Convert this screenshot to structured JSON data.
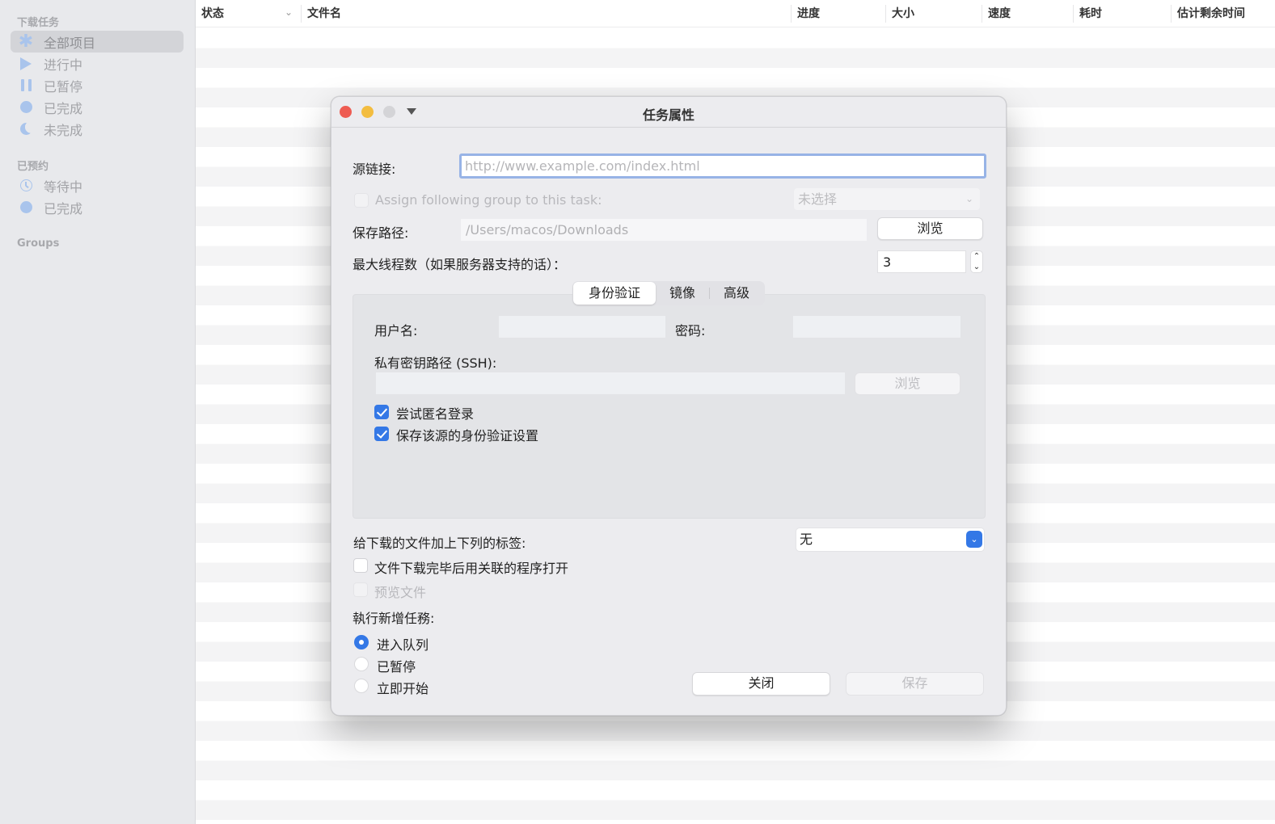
{
  "sidebar": {
    "sections": [
      {
        "title": "下载任务",
        "items": [
          {
            "label": "全部项目",
            "icon": "asterisk-icon",
            "selected": true
          },
          {
            "label": "进行中",
            "icon": "play-icon"
          },
          {
            "label": "已暂停",
            "icon": "pause-icon"
          },
          {
            "label": "已完成",
            "icon": "circle-icon"
          },
          {
            "label": "未完成",
            "icon": "moon-icon"
          }
        ]
      },
      {
        "title": "已预约",
        "items": [
          {
            "label": "等待中",
            "icon": "clock-icon"
          },
          {
            "label": "已完成",
            "icon": "circle-icon"
          }
        ]
      },
      {
        "title": "Groups",
        "items": []
      }
    ]
  },
  "table": {
    "columns": [
      "状态",
      "文件名",
      "进度",
      "大小",
      "速度",
      "耗时",
      "估计剩余时间"
    ],
    "sort_indicator": "⌄",
    "rows": []
  },
  "dialog": {
    "title": "任务属性",
    "source_url": {
      "label": "源链接:",
      "placeholder": "http://www.example.com/index.html",
      "value": ""
    },
    "assign_group": {
      "label": "Assign following group to this task:",
      "checked": false,
      "enabled": false,
      "selected": "未选择"
    },
    "save_path": {
      "label": "保存路径:",
      "placeholder": "/Users/macos/Downloads",
      "browse_label": "浏览"
    },
    "max_threads": {
      "label": "最大线程数（如果服务器支持的话）：",
      "value": "3",
      "up": "⌃",
      "down": "⌄"
    },
    "tabs": [
      {
        "label": "身份验证",
        "active": true
      },
      {
        "label": "镜像",
        "active": false
      },
      {
        "label": "高级",
        "active": false
      }
    ],
    "auth": {
      "username_label": "用户名:",
      "username_value": "",
      "password_label": "密码:",
      "password_value": "",
      "ssh_key_label": "私有密钥路径 (SSH):",
      "ssh_key_value": "",
      "ssh_browse_label": "浏览",
      "anonymous_login": {
        "label": "尝试匿名登录",
        "checked": true
      },
      "save_auth": {
        "label": "保存该源的身份验证设置",
        "checked": true
      }
    },
    "tag": {
      "label": "给下载的文件加上下列的标签:",
      "selected": "无",
      "chevron": "⌄"
    },
    "open_after": {
      "label": "文件下载完毕后用关联的程序打开",
      "checked": false
    },
    "preview": {
      "label": "预览文件",
      "checked": false,
      "enabled": false
    },
    "new_task": {
      "label": "執行新增任務:",
      "options": [
        {
          "label": "进入队列",
          "selected": true
        },
        {
          "label": "已暂停",
          "selected": false
        },
        {
          "label": "立即开始",
          "selected": false
        }
      ]
    },
    "close_label": "关闭",
    "save_label": "保存"
  }
}
